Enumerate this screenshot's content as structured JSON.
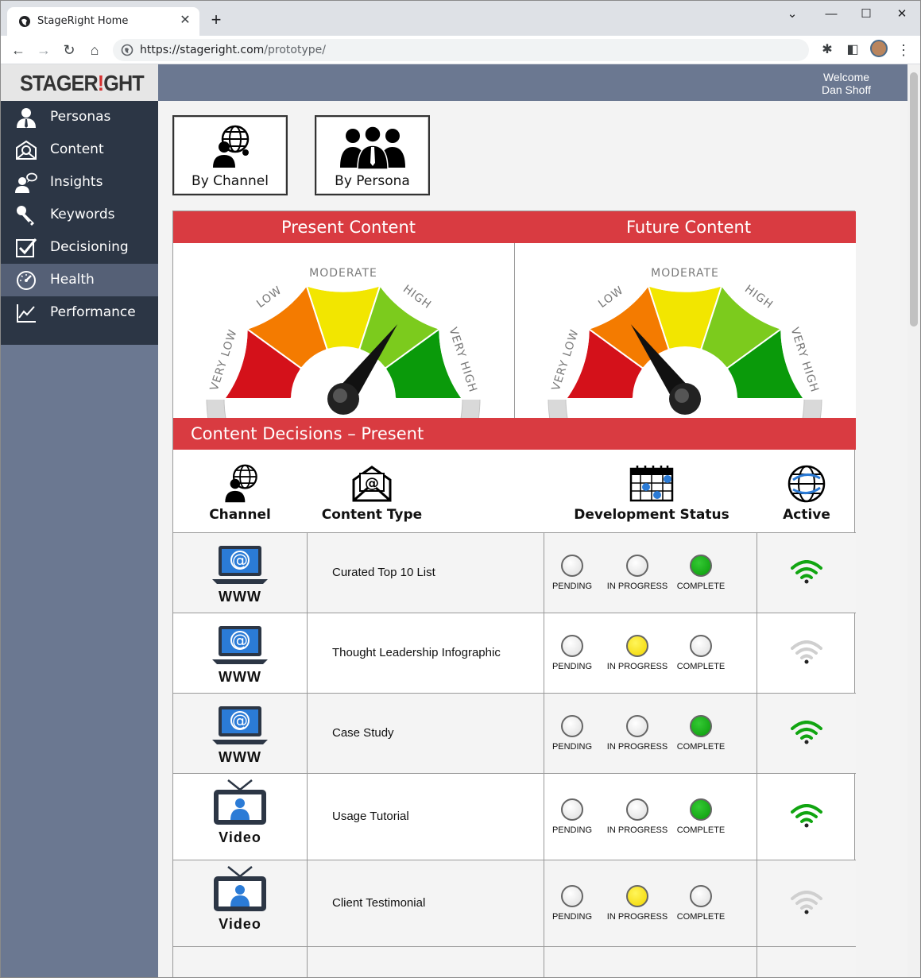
{
  "browser": {
    "tab_title": "StageRight Home",
    "url_host": "https://stageright.com",
    "url_path": "/prototype/"
  },
  "app": {
    "logo_a": "STAGER",
    "logo_b": "!",
    "logo_c": "GHT",
    "welcome_line1": "Welcome",
    "welcome_line2": "Dan Shoff"
  },
  "sidebar": {
    "items": [
      {
        "label": "Personas",
        "icon": "person-icon"
      },
      {
        "label": "Content",
        "icon": "email-icon"
      },
      {
        "label": "Insights",
        "icon": "chat-person-icon"
      },
      {
        "label": "Keywords",
        "icon": "key-icon"
      },
      {
        "label": "Decisioning",
        "icon": "checkbox-icon"
      },
      {
        "label": "Health",
        "icon": "gauge-icon",
        "active": true
      },
      {
        "label": "Performance",
        "icon": "chart-icon"
      }
    ]
  },
  "views": {
    "by_channel": "By Channel",
    "by_persona": "By Persona"
  },
  "gauges": {
    "present_title": "Present Content",
    "future_title": "Future Content",
    "labels": [
      "VERY LOW",
      "LOW",
      "MODERATE",
      "HIGH",
      "VERY HIGH"
    ],
    "colors": [
      "#d4111a",
      "#f47b00",
      "#f2e600",
      "#7ccb1d",
      "#0a9a0a"
    ],
    "present_level": "HIGH",
    "future_level": "LOW"
  },
  "decisions": {
    "title": "Content Decisions – Present",
    "col_channel": "Channel",
    "col_content_type": "Content Type",
    "col_dev_status": "Development Status",
    "col_active": "Active",
    "status_labels": [
      "PENDING",
      "IN PROGRESS",
      "COMPLETE"
    ],
    "rows": [
      {
        "channel": "WWW",
        "content_type": "Curated Top 10 List",
        "status": "COMPLETE",
        "active": true
      },
      {
        "channel": "WWW",
        "content_type": "Thought Leadership Infographic",
        "status": "IN PROGRESS",
        "active": false
      },
      {
        "channel": "WWW",
        "content_type": "Case Study",
        "status": "COMPLETE",
        "active": true
      },
      {
        "channel": "Video",
        "content_type": "Usage Tutorial",
        "status": "COMPLETE",
        "active": true
      },
      {
        "channel": "Video",
        "content_type": "Client Testimonial",
        "status": "IN PROGRESS",
        "active": false
      }
    ]
  }
}
